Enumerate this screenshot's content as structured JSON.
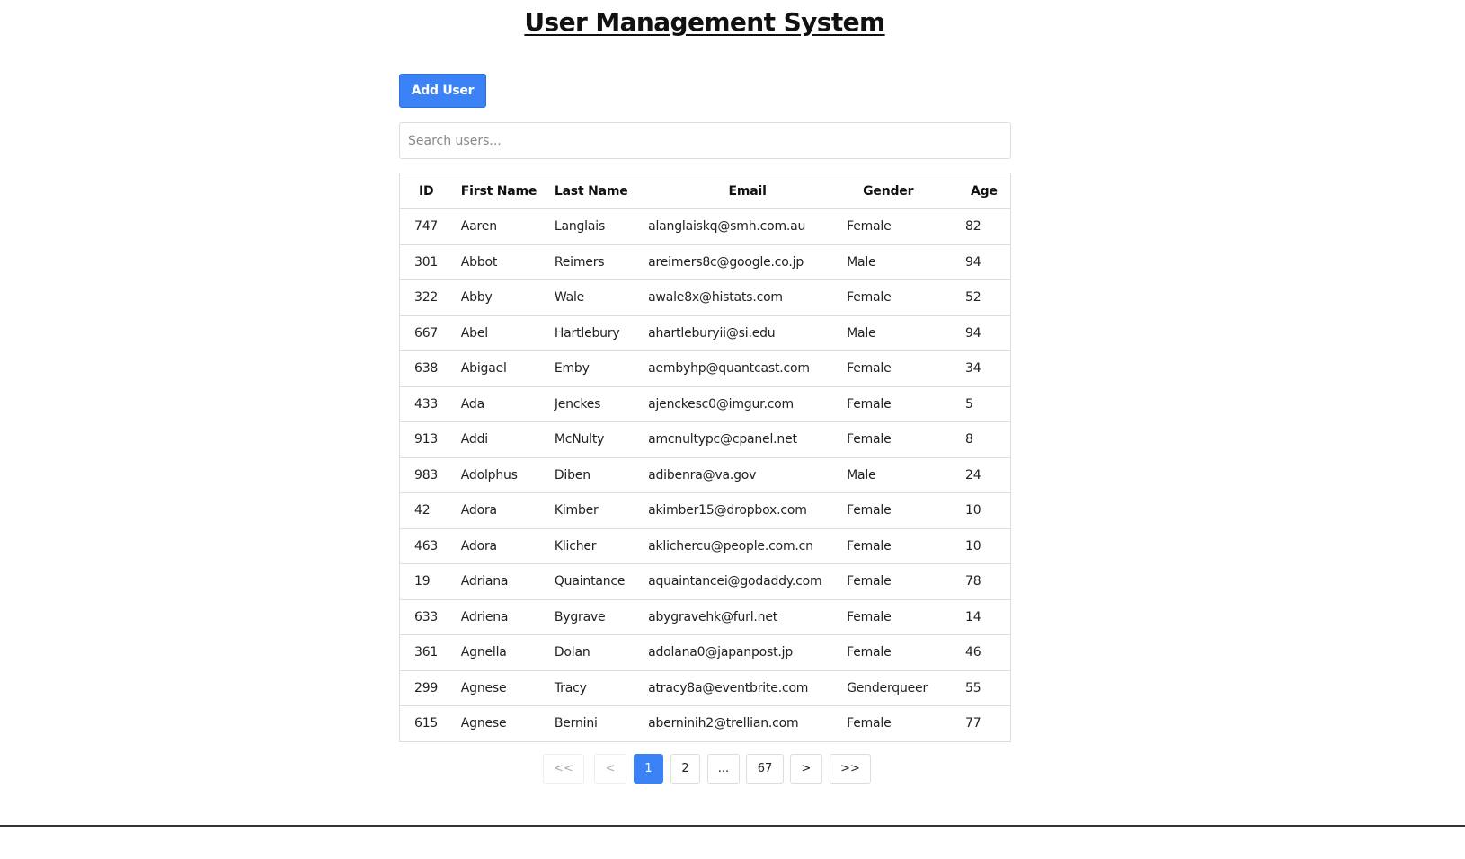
{
  "page": {
    "title": "User Management System"
  },
  "toolbar": {
    "add_user_label": "Add User"
  },
  "search": {
    "placeholder": "Search users...",
    "value": ""
  },
  "table": {
    "headers": {
      "id": "ID",
      "first": "First Name",
      "last": "Last Name",
      "email": "Email",
      "gender": "Gender",
      "age": "Age"
    },
    "rows": [
      {
        "id": "747",
        "first": "Aaren",
        "last": "Langlais",
        "email": "alanglaiskq@smh.com.au",
        "gender": "Female",
        "age": "82"
      },
      {
        "id": "301",
        "first": "Abbot",
        "last": "Reimers",
        "email": "areimers8c@google.co.jp",
        "gender": "Male",
        "age": "94"
      },
      {
        "id": "322",
        "first": "Abby",
        "last": "Wale",
        "email": "awale8x@histats.com",
        "gender": "Female",
        "age": "52"
      },
      {
        "id": "667",
        "first": "Abel",
        "last": "Hartlebury",
        "email": "ahartleburyii@si.edu",
        "gender": "Male",
        "age": "94"
      },
      {
        "id": "638",
        "first": "Abigael",
        "last": "Emby",
        "email": "aembyhp@quantcast.com",
        "gender": "Female",
        "age": "34"
      },
      {
        "id": "433",
        "first": "Ada",
        "last": "Jenckes",
        "email": "ajenckesc0@imgur.com",
        "gender": "Female",
        "age": "5"
      },
      {
        "id": "913",
        "first": "Addi",
        "last": "McNulty",
        "email": "amcnultypc@cpanel.net",
        "gender": "Female",
        "age": "8"
      },
      {
        "id": "983",
        "first": "Adolphus",
        "last": "Diben",
        "email": "adibenra@va.gov",
        "gender": "Male",
        "age": "24"
      },
      {
        "id": "42",
        "first": "Adora",
        "last": "Kimber",
        "email": "akimber15@dropbox.com",
        "gender": "Female",
        "age": "10"
      },
      {
        "id": "463",
        "first": "Adora",
        "last": "Klicher",
        "email": "aklichercu@people.com.cn",
        "gender": "Female",
        "age": "10"
      },
      {
        "id": "19",
        "first": "Adriana",
        "last": "Quaintance",
        "email": "aquaintancei@godaddy.com",
        "gender": "Female",
        "age": "78"
      },
      {
        "id": "633",
        "first": "Adriena",
        "last": "Bygrave",
        "email": "abygravehk@furl.net",
        "gender": "Female",
        "age": "14"
      },
      {
        "id": "361",
        "first": "Agnella",
        "last": "Dolan",
        "email": "adolana0@japanpost.jp",
        "gender": "Female",
        "age": "46"
      },
      {
        "id": "299",
        "first": "Agnese",
        "last": "Tracy",
        "email": "atracy8a@eventbrite.com",
        "gender": "Genderqueer",
        "age": "55"
      },
      {
        "id": "615",
        "first": "Agnese",
        "last": "Bernini",
        "email": "aberninih2@trellian.com",
        "gender": "Female",
        "age": "77"
      }
    ]
  },
  "pagination": {
    "first": "<<",
    "prev": "<",
    "p1": "1",
    "p2": "2",
    "ellipsis": "...",
    "last_page": "67",
    "next": ">",
    "last": ">>",
    "current_page": 1
  },
  "colors": {
    "accent": "#3b82f6",
    "border": "#dddddd"
  }
}
